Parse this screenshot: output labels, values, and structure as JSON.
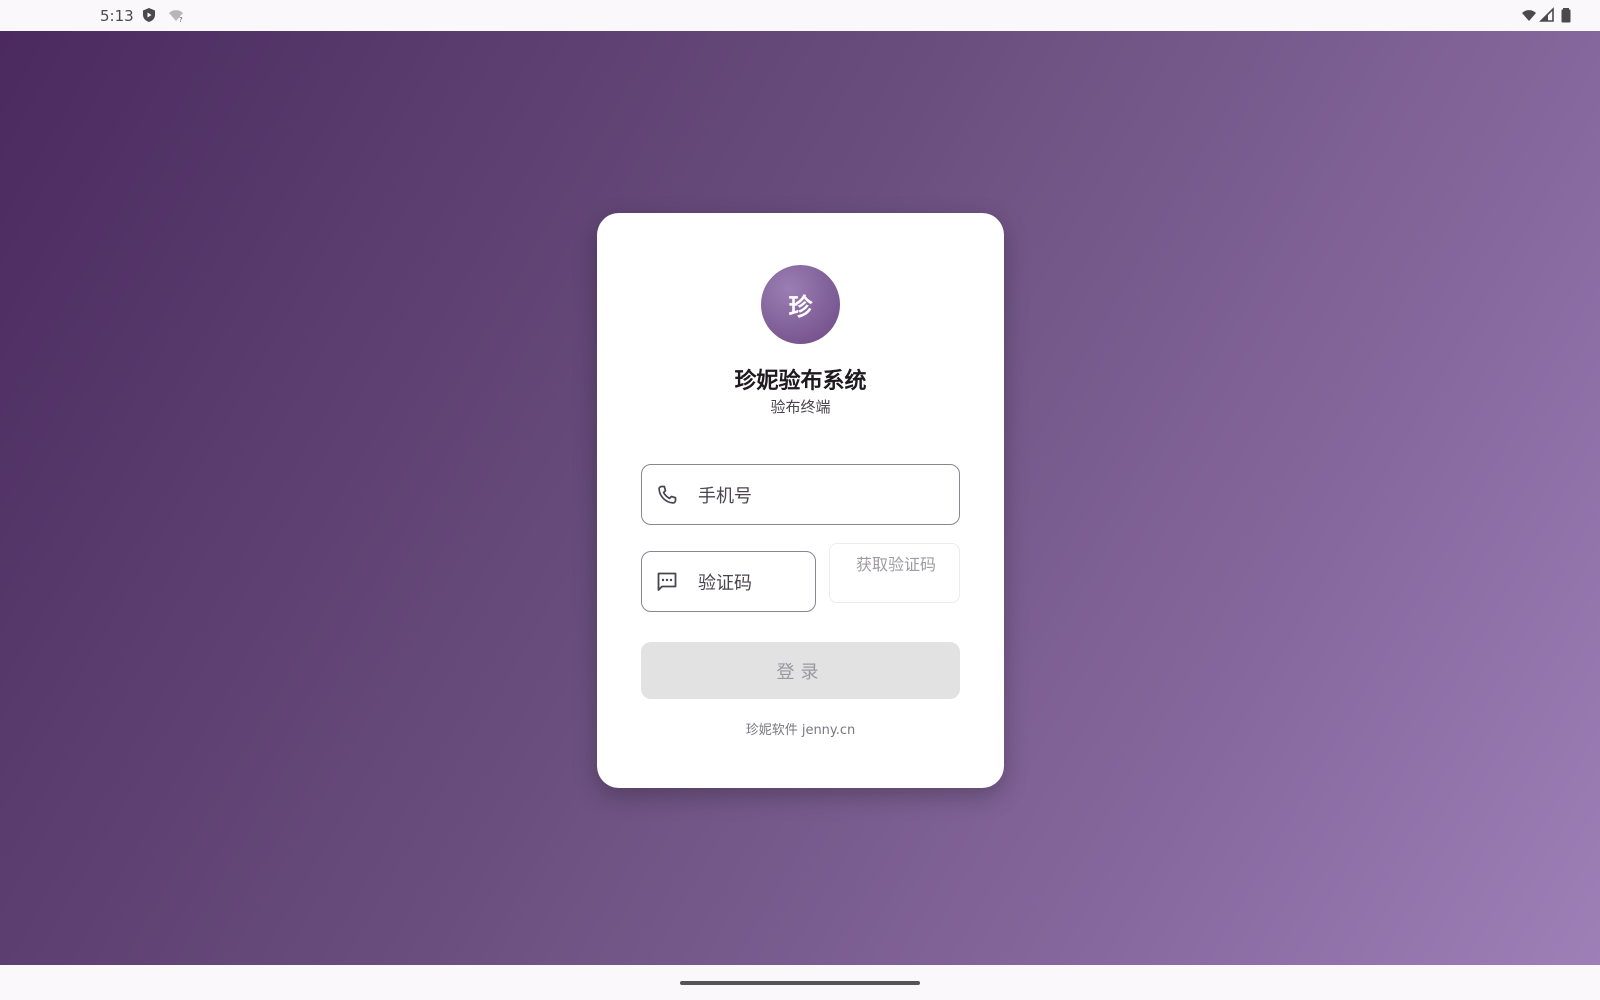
{
  "status_bar": {
    "time": "5:13"
  },
  "app": {
    "logo_char": "珍",
    "title": "珍妮验布系统",
    "subtitle": "验布终端"
  },
  "form": {
    "phone_placeholder": "手机号",
    "code_placeholder": "验证码",
    "get_code_label": "获取验证码",
    "login_label": "登录"
  },
  "footer": {
    "text": "珍妮软件 jenny.cn"
  },
  "icons": {
    "phone": "phone-icon",
    "code": "message-dots-icon"
  },
  "colors": {
    "gradient_start": "#4b2a5f",
    "gradient_end": "#9e7fb6",
    "logo": "#7b5892",
    "disabled_button": "#e2e2e3"
  }
}
